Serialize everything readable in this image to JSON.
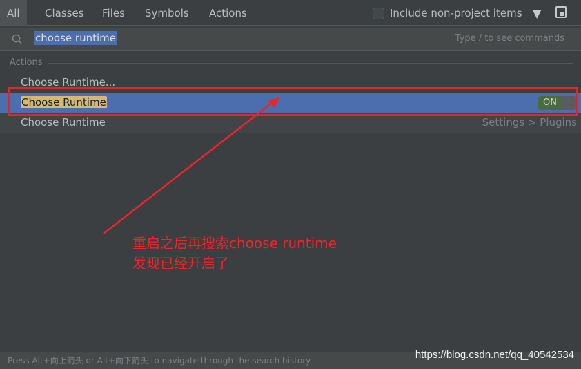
{
  "tabs": [
    "All",
    "Classes",
    "Files",
    "Symbols",
    "Actions"
  ],
  "include_label": "Include non-project items",
  "include_checked": false,
  "icons": [
    "filter-icon",
    "preview-icon",
    "search-icon"
  ],
  "search": {
    "value": "choose runtime",
    "hint": "Type / to see commands"
  },
  "section": "Actions",
  "results": [
    {
      "label": "Choose Runtime..."
    },
    {
      "label": "Choose Runtime",
      "selected": true,
      "toggle": "ON"
    },
    {
      "label": "Choose Runtime",
      "location": "Settings > Plugins"
    }
  ],
  "annotation": {
    "line1": "重启之后再搜索choose runtime",
    "line2": "发现已经开启了",
    "color": "#e8262c"
  },
  "footer": "Press Alt+向上箭头 or Alt+向下箭头 to navigate through the search history",
  "watermark": "https://blog.csdn.net/qq_40542534"
}
